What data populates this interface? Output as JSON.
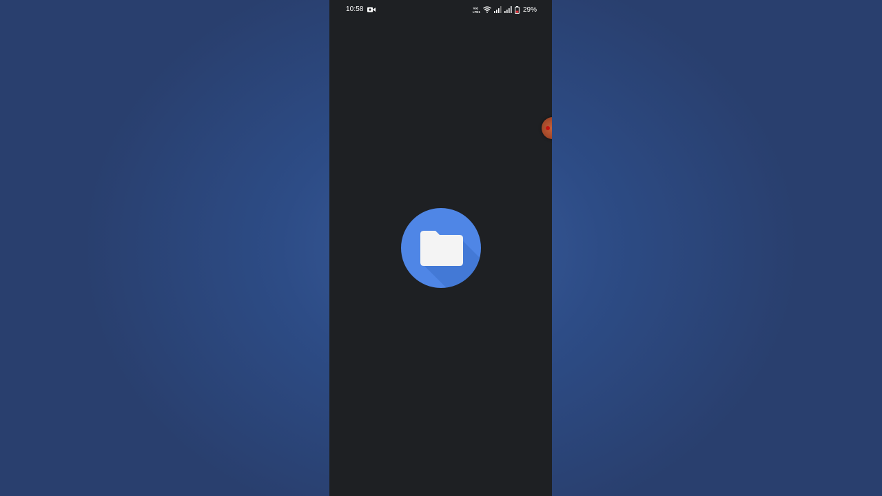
{
  "status_bar": {
    "time": "10:58",
    "recording_icon": "video-camera-icon",
    "network_label": "Vo) LTE1",
    "wifi_icon": "wifi-icon",
    "signal_icons": [
      "signal-sim1-icon",
      "signal-sim2-icon"
    ],
    "battery_icon": "battery-low-icon",
    "battery_percent": "29%"
  },
  "splash": {
    "icon": "files-folder-icon",
    "accent_color": "#4f86e6",
    "folder_color": "#f4f4f4"
  },
  "floating_bubble": {
    "icon": "screen-recorder-bubble-icon",
    "color": "#b0502e"
  },
  "colors": {
    "backdrop": "#2d4c86",
    "phone_background": "#1e2023"
  }
}
